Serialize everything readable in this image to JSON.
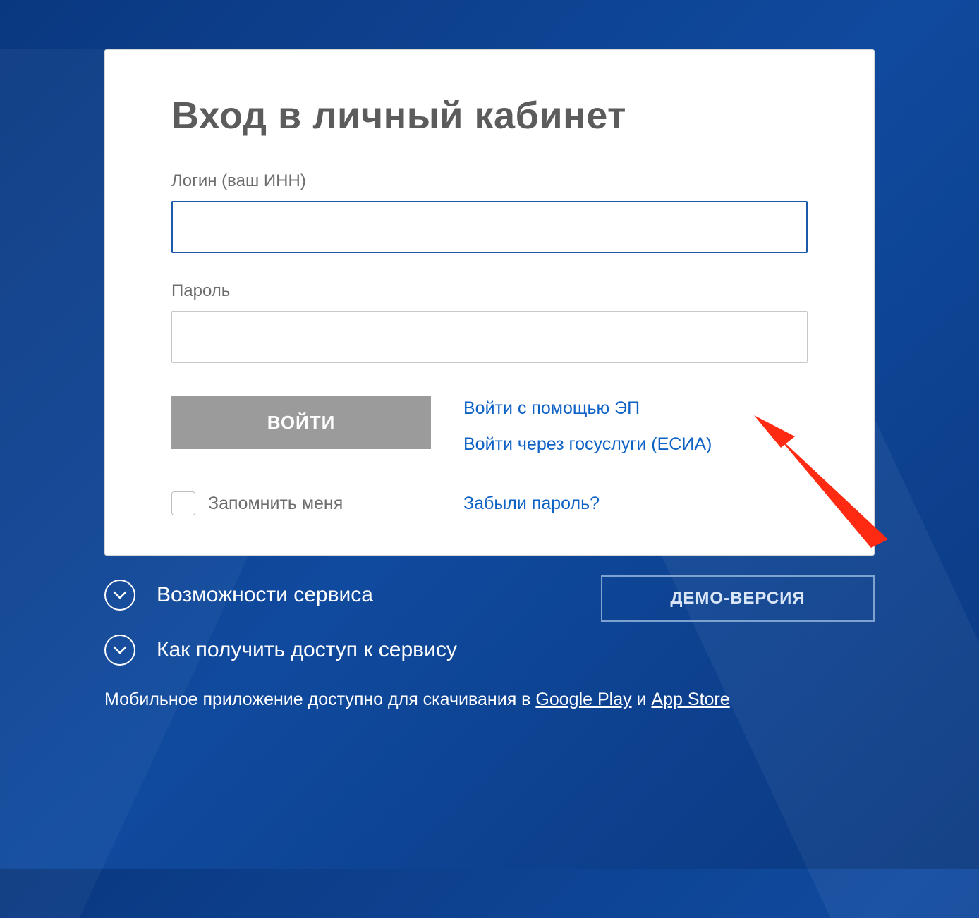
{
  "card": {
    "title": "Вход в личный кабинет",
    "login_label": "Логин (ваш ИНН)",
    "login_value": "",
    "password_label": "Пароль",
    "password_value": "",
    "submit_label": "ВОЙТИ",
    "ep_link": "Войти с помощью ЭП",
    "esia_link": "Войти через госуслуги (ЕСИА)",
    "remember_label": "Запомнить меня",
    "forgot_label": "Забыли пароль?"
  },
  "expanders": {
    "features": "Возможности сервиса",
    "howto": "Как получить доступ к сервису"
  },
  "demo_button": "ДЕМО-ВЕРСИЯ",
  "app_line": {
    "prefix": "Мобильное приложение доступно для скачивания в ",
    "google": "Google Play",
    "mid": " и ",
    "apple": "App Store"
  }
}
